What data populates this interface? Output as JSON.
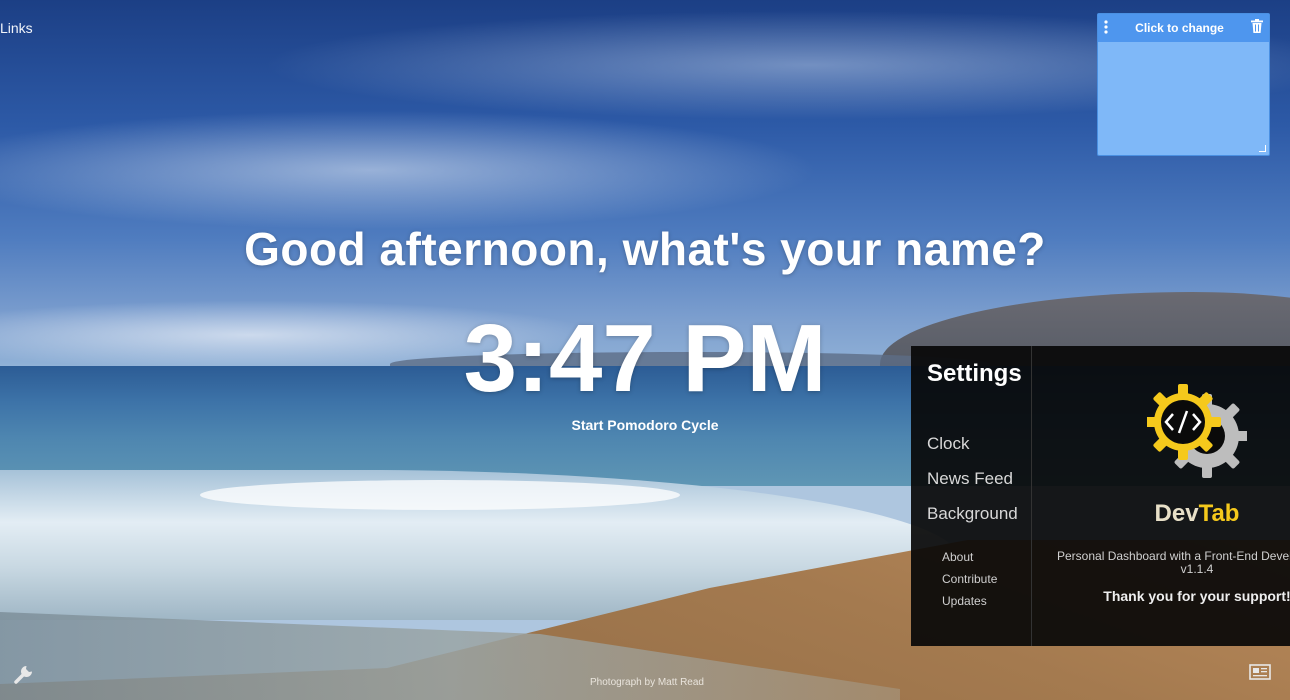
{
  "links": {
    "label": "Links"
  },
  "note": {
    "title": "Click to change"
  },
  "greeting": {
    "text": "Good afternoon, what's your name?"
  },
  "clock": {
    "time": "3:47 PM"
  },
  "pomodoro": {
    "label": "Start Pomodoro Cycle"
  },
  "settings": {
    "title": "Settings",
    "nav": [
      "Clock",
      "News Feed",
      "Background"
    ],
    "subnav": [
      "About",
      "Contribute",
      "Updates"
    ],
    "brand_dev": "Dev",
    "brand_tab": "Tab",
    "tagline": "Personal Dashboard with a Front-End Develop",
    "version": "v1.1.4",
    "thanks": "Thank you for your support!"
  },
  "footer": {
    "credit": "Photograph by Matt Read"
  },
  "icons": {
    "note_menu": "vertical-dots-icon",
    "note_delete": "trash-icon",
    "settings_toggle": "wrench-icon",
    "news_toggle": "newspaper-icon",
    "logo": "gear-code-logo"
  },
  "colors": {
    "note_header": "#4e96ee",
    "note_body": "#7fb8f8",
    "brand_accent": "#f5c91c",
    "panel_bg": "#080808"
  }
}
